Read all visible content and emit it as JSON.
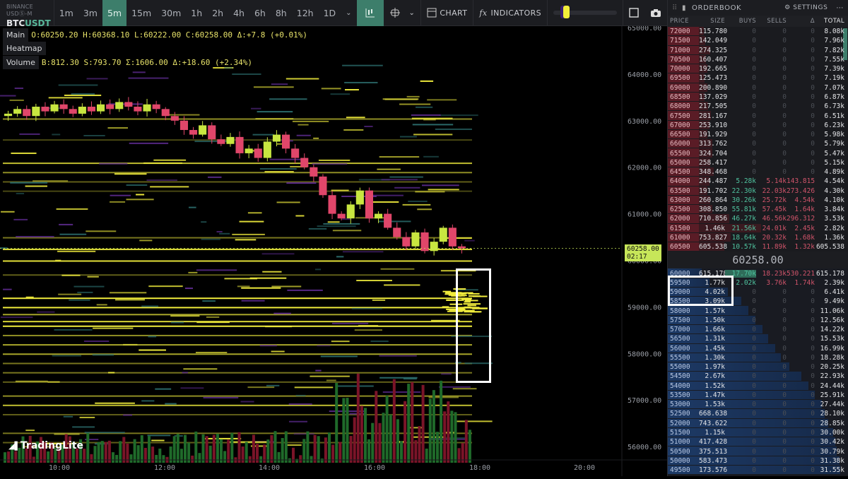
{
  "header": {
    "exchange": "BINANCE USDⓈ-M",
    "base": "BTC",
    "quote": "USDT",
    "timeframes": [
      "1m",
      "3m",
      "5m",
      "15m",
      "30m",
      "1h",
      "2h",
      "4h",
      "6h",
      "8h",
      "12h",
      "1D"
    ],
    "active_timeframe": "5m",
    "chart_label": "CHART",
    "indicators_label": "INDICATORS"
  },
  "legend": {
    "main_label": "Main",
    "main_values": "O:60250.20 H:60368.10 L:60222.00 C:60258.00 Δ:+7.8 (+0.01%)",
    "heatmap_label": "Heatmap",
    "volume_label": "Volume",
    "volume_values": "B:812.30 S:793.70 Σ:1606.00 Δ:+18.60 (+2.34%)"
  },
  "price_axis": [
    "65000.00",
    "64000.00",
    "63000.00",
    "62000.00",
    "61000.00",
    "60000.00",
    "59000.00",
    "58000.00",
    "57000.00",
    "56000.00"
  ],
  "time_axis": [
    "10:00",
    "12:00",
    "14:00",
    "16:00",
    "18:00",
    "20:00"
  ],
  "last_price": {
    "price": "60258.00",
    "countdown": "02:17"
  },
  "brand": "TradingLite",
  "colors": {
    "up": "#c8e640",
    "down": "#e0466a",
    "heat": "#f0ec3c",
    "accent": "#3d7e6b"
  },
  "candle_closes": [
    63150,
    63250,
    63100,
    63300,
    63200,
    63350,
    63250,
    63150,
    63300,
    63200,
    63350,
    63250,
    63400,
    63300,
    63200,
    63350,
    63250,
    63100,
    63000,
    62800,
    62700,
    62900,
    62600,
    62500,
    62650,
    62300,
    62400,
    62200,
    62550,
    62700,
    62400,
    62200,
    62000,
    61800,
    61400,
    61000,
    60900,
    61200,
    61500,
    60900,
    61000,
    60700,
    60500,
    60300,
    60600,
    60200,
    60400,
    60700,
    60300,
    60258
  ],
  "orderbook": {
    "title": "ORDERBOOK",
    "settings_label": "SETTINGS",
    "mid_price": "60258.00",
    "columns": [
      "PRICE",
      "SIZE",
      "BUYS",
      "SELLS",
      "Δ",
      "TOTAL"
    ],
    "asks": [
      [
        "72000",
        "115.780",
        "0",
        "0",
        "0",
        "8.08k"
      ],
      [
        "71500",
        "142.049",
        "0",
        "0",
        "0",
        "7.96k"
      ],
      [
        "71000",
        "274.325",
        "0",
        "0",
        "0",
        "7.82k"
      ],
      [
        "70500",
        "160.407",
        "0",
        "0",
        "0",
        "7.55k"
      ],
      [
        "70000",
        "192.665",
        "0",
        "0",
        "0",
        "7.39k"
      ],
      [
        "69500",
        "125.473",
        "0",
        "0",
        "0",
        "7.19k"
      ],
      [
        "69000",
        "200.890",
        "0",
        "0",
        "0",
        "7.07k"
      ],
      [
        "68500",
        "137.029",
        "0",
        "0",
        "0",
        "6.87k"
      ],
      [
        "68000",
        "217.505",
        "0",
        "0",
        "0",
        "6.73k"
      ],
      [
        "67500",
        "281.167",
        "0",
        "0",
        "0",
        "6.51k"
      ],
      [
        "67000",
        "253.910",
        "0",
        "0",
        "0",
        "6.23k"
      ],
      [
        "66500",
        "191.929",
        "0",
        "0",
        "0",
        "5.98k"
      ],
      [
        "66000",
        "313.762",
        "0",
        "0",
        "0",
        "5.79k"
      ],
      [
        "65500",
        "324.704",
        "0",
        "0",
        "0",
        "5.47k"
      ],
      [
        "65000",
        "258.417",
        "0",
        "0",
        "0",
        "5.15k"
      ],
      [
        "64500",
        "348.468",
        "0",
        "0",
        "0",
        "4.89k"
      ],
      [
        "64000",
        "244.487",
        "5.28k",
        "5.14k",
        "143.815",
        "4.54k"
      ],
      [
        "63500",
        "191.702",
        "22.30k",
        "22.03k",
        "273.426",
        "4.30k"
      ],
      [
        "63000",
        "260.864",
        "30.26k",
        "25.72k",
        "4.54k",
        "4.10k"
      ],
      [
        "62500",
        "308.850",
        "55.81k",
        "57.45k",
        "1.64k",
        "3.84k"
      ],
      [
        "62000",
        "710.856",
        "46.27k",
        "46.56k",
        "296.312",
        "3.53k"
      ],
      [
        "61500",
        "1.46k",
        "21.56k",
        "24.01k",
        "2.45k",
        "2.82k"
      ],
      [
        "61000",
        "753.827",
        "18.64k",
        "20.32k",
        "1.68k",
        "1.36k"
      ],
      [
        "60500",
        "605.538",
        "10.57k",
        "11.89k",
        "1.32k",
        "605.538"
      ]
    ],
    "bids": [
      [
        "60000",
        "615.178",
        "17.70k",
        "18.23k",
        "530.221",
        "615.178"
      ],
      [
        "59500",
        "1.77k",
        "2.02k",
        "3.76k",
        "1.74k",
        "2.39k"
      ],
      [
        "59000",
        "4.02k",
        "0",
        "0",
        "0",
        "6.41k"
      ],
      [
        "58500",
        "3.09k",
        "0",
        "0",
        "0",
        "9.49k"
      ],
      [
        "58000",
        "1.57k",
        "0",
        "0",
        "0",
        "11.06k"
      ],
      [
        "57500",
        "1.50k",
        "0",
        "0",
        "0",
        "12.56k"
      ],
      [
        "57000",
        "1.66k",
        "0",
        "0",
        "0",
        "14.22k"
      ],
      [
        "56500",
        "1.31k",
        "0",
        "0",
        "0",
        "15.53k"
      ],
      [
        "56000",
        "1.45k",
        "0",
        "0",
        "0",
        "16.99k"
      ],
      [
        "55500",
        "1.30k",
        "0",
        "0",
        "0",
        "18.28k"
      ],
      [
        "55000",
        "1.97k",
        "0",
        "0",
        "0",
        "20.25k"
      ],
      [
        "54500",
        "2.67k",
        "0",
        "0",
        "0",
        "22.93k"
      ],
      [
        "54000",
        "1.52k",
        "0",
        "0",
        "0",
        "24.44k"
      ],
      [
        "53500",
        "1.47k",
        "0",
        "0",
        "0",
        "25.91k"
      ],
      [
        "53000",
        "1.53k",
        "0",
        "0",
        "0",
        "27.44k"
      ],
      [
        "52500",
        "668.638",
        "0",
        "0",
        "0",
        "28.10k"
      ],
      [
        "52000",
        "743.622",
        "0",
        "0",
        "0",
        "28.85k"
      ],
      [
        "51500",
        "1.15k",
        "0",
        "0",
        "0",
        "30.00k"
      ],
      [
        "51000",
        "417.428",
        "0",
        "0",
        "0",
        "30.42k"
      ],
      [
        "50500",
        "375.513",
        "0",
        "0",
        "0",
        "30.79k"
      ],
      [
        "50000",
        "583.473",
        "0",
        "0",
        "0",
        "31.38k"
      ],
      [
        "49500",
        "173.576",
        "0",
        "0",
        "0",
        "31.55k"
      ]
    ]
  }
}
